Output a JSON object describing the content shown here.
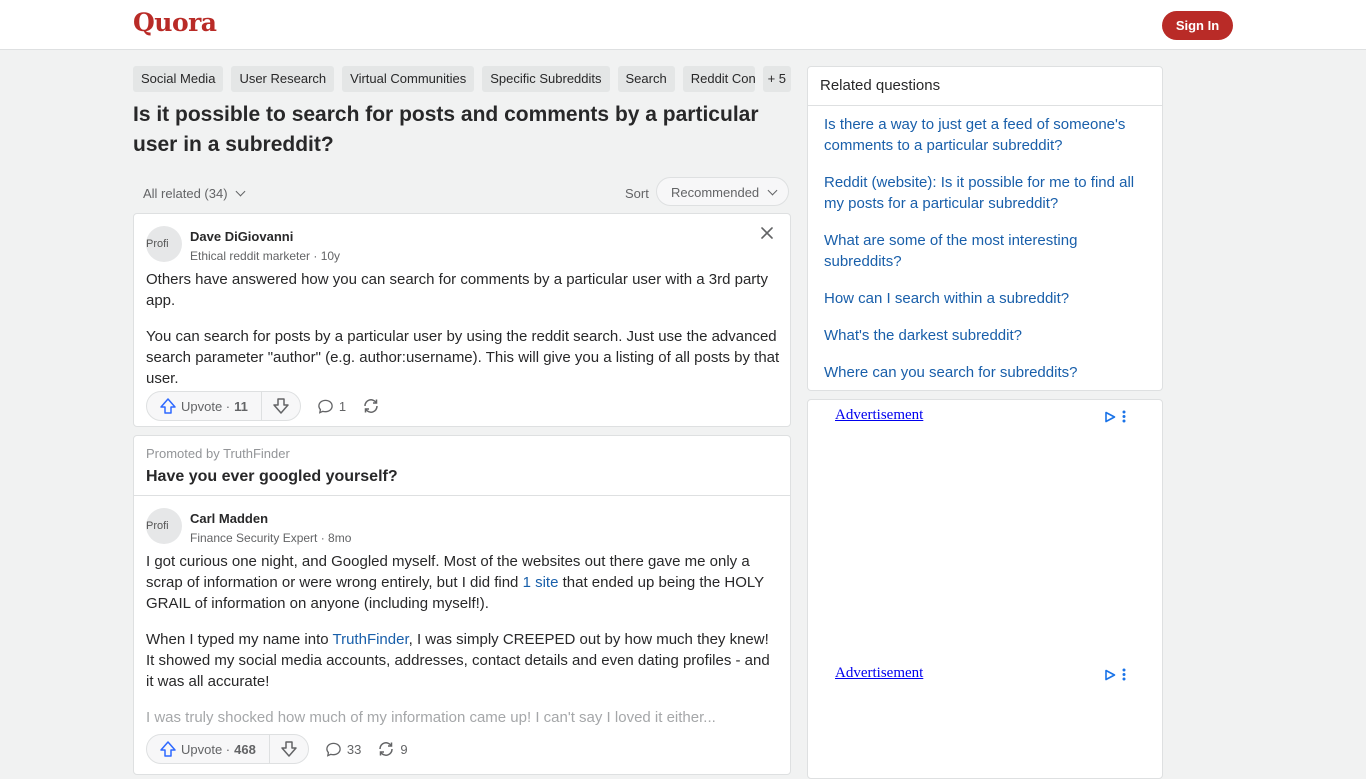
{
  "header": {
    "logo": "Quora",
    "signin_label": "Sign In"
  },
  "topics": [
    "Social Media",
    "User Research",
    "Virtual Communities",
    "Specific Subreddits",
    "Search",
    "Reddit Conte",
    "+ 5"
  ],
  "question": {
    "title": "Is it possible to search for posts and comments by a particular user in a subreddit?"
  },
  "filter": {
    "all_related": "All related (34)",
    "sort_label": "Sort",
    "sort_value": "Recommended"
  },
  "answers": [
    {
      "avatar_alt": "Profi",
      "author": "Dave DiGiovanni",
      "credential": "Ethical reddit marketer · 10y",
      "paragraphs": [
        "Others have answered how you can search for comments by a particular user with a 3rd party app.",
        "You can search for posts by a particular user by using the reddit search. Just use the advanced search parameter \"author\" (e.g. author:username). This will give you a listing of all posts by that user."
      ],
      "upvote_label": "Upvote ·",
      "upvotes": "11",
      "comments": "1",
      "shares": ""
    }
  ],
  "promoted": {
    "label": "Promoted by TruthFinder",
    "title": "Have you ever googled yourself?",
    "avatar_alt": "Profi",
    "author": "Carl Madden",
    "credential": "Finance Security Expert · 8mo",
    "p1_a": "I got curious one night, and Googled myself. Most of the websites out there gave me only a scrap of information or were wrong entirely, but I did find ",
    "p1_link": "1 site",
    "p1_b": " that ended up being the HOLY GRAIL of information on anyone (including myself!).",
    "p2_a": "When I typed my name into ",
    "p2_link": "TruthFinder",
    "p2_b": ", I was simply CREEPED out by how much they knew! It showed my social media accounts, addresses, contact details and even dating profiles - and it was all accurate!",
    "p3": "I was truly shocked how much of my information came up! I can't say I loved it either...",
    "upvote_label": "Upvote ·",
    "upvotes": "468",
    "comments": "33",
    "shares": "9"
  },
  "related": {
    "heading": "Related questions",
    "items": [
      "Is there a way to just get a feed of someone's comments to a particular subreddit?",
      "Reddit (website): Is it possible for me to find all my posts for a particular subreddit?",
      "What are some of the most interesting subreddits?",
      "How can I search within a subreddit?",
      "What's the darkest subreddit?",
      "Where can you search for subreddits?"
    ]
  },
  "ads": [
    "Advertisement",
    "Advertisement"
  ],
  "colors": {
    "brand": "#b92b27",
    "link": "#195faa",
    "adchoices": "#1a73e8"
  }
}
